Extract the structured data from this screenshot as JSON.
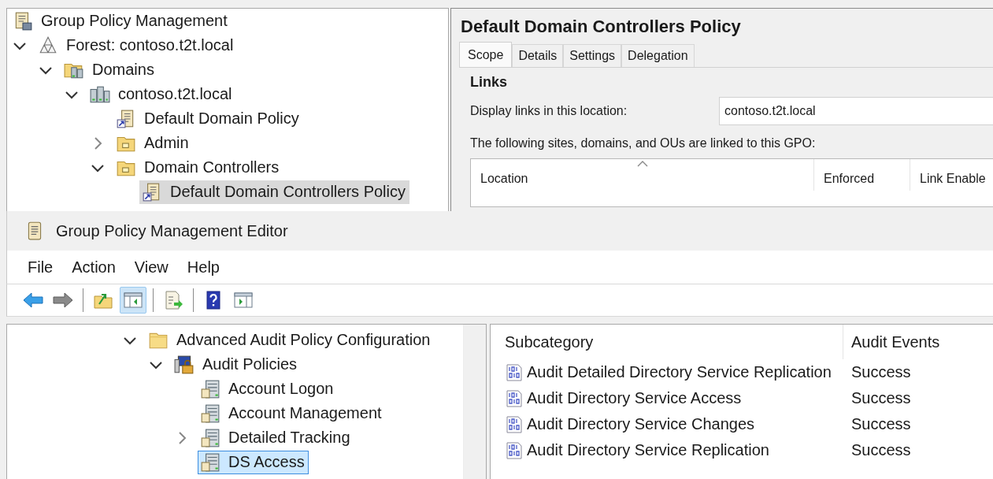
{
  "gpm": {
    "tree_focused": false,
    "root": {
      "label": "Group Policy Management",
      "kind": "gpm"
    },
    "tree": [
      {
        "label": "Forest: contoso.t2t.local",
        "kind": "forest",
        "expanded": true,
        "selected": false,
        "children": [
          {
            "label": "Domains",
            "kind": "domains",
            "expanded": true,
            "selected": false,
            "children": [
              {
                "label": "contoso.t2t.local",
                "kind": "domain",
                "expanded": true,
                "selected": false,
                "children": [
                  {
                    "label": "Default Domain Policy",
                    "kind": "gpo",
                    "selected": false
                  },
                  {
                    "label": "Admin",
                    "kind": "ou",
                    "expanded": false,
                    "selected": false
                  },
                  {
                    "label": "Domain Controllers",
                    "kind": "ou",
                    "expanded": true,
                    "selected": false,
                    "children": [
                      {
                        "label": "Default Domain Controllers Policy",
                        "kind": "gpo",
                        "selected": true
                      }
                    ]
                  }
                ]
              }
            ]
          }
        ]
      }
    ]
  },
  "gpo_pane": {
    "title": "Default Domain Controllers Policy",
    "tabs": [
      {
        "label": "Scope",
        "selected": true
      },
      {
        "label": "Details",
        "selected": false
      },
      {
        "label": "Settings",
        "selected": false
      },
      {
        "label": "Delegation",
        "selected": false
      }
    ],
    "section": "Links",
    "location_label": "Display links in this location:",
    "location_value": "contoso.t2t.local",
    "links_caption": "The following sites, domains, and OUs are linked to this GPO:",
    "columns": [
      {
        "label": "Location",
        "sorted": true
      },
      {
        "label": "Enforced",
        "sorted": false
      },
      {
        "label": "Link Enable",
        "sorted": false
      }
    ]
  },
  "editor": {
    "title": "Group Policy Management Editor",
    "menu": [
      "File",
      "Action",
      "View",
      "Help"
    ],
    "toolbar": [
      {
        "kind": "back",
        "pressed": false
      },
      {
        "kind": "forward",
        "pressed": false
      },
      {
        "kind": "separator"
      },
      {
        "kind": "up",
        "pressed": false
      },
      {
        "kind": "tree",
        "pressed": true
      },
      {
        "kind": "separator"
      },
      {
        "kind": "export",
        "pressed": false
      },
      {
        "kind": "separator"
      },
      {
        "kind": "help",
        "pressed": false
      },
      {
        "kind": "pane",
        "pressed": false
      }
    ],
    "tree_focused": true,
    "tree": [
      {
        "label": "Advanced Audit Policy Configuration",
        "kind": "folder",
        "expanded": true,
        "selected": false,
        "children": [
          {
            "label": "Audit Policies",
            "kind": "audit",
            "expanded": true,
            "selected": false,
            "children": [
              {
                "label": "Account Logon",
                "kind": "category",
                "selected": false
              },
              {
                "label": "Account Management",
                "kind": "category",
                "selected": false
              },
              {
                "label": "Detailed Tracking",
                "kind": "category",
                "expanded": false,
                "selected": false
              },
              {
                "label": "DS Access",
                "kind": "category",
                "selected": true
              }
            ]
          }
        ]
      }
    ],
    "list": {
      "columns": [
        "Subcategory",
        "Audit Events"
      ],
      "rows": [
        {
          "subcategory": "Audit Detailed Directory Service Replication",
          "audit_events": "Success"
        },
        {
          "subcategory": "Audit Directory Service Access",
          "audit_events": "Success"
        },
        {
          "subcategory": "Audit Directory Service Changes",
          "audit_events": "Success"
        },
        {
          "subcategory": "Audit Directory Service Replication",
          "audit_events": "Success"
        }
      ]
    }
  }
}
